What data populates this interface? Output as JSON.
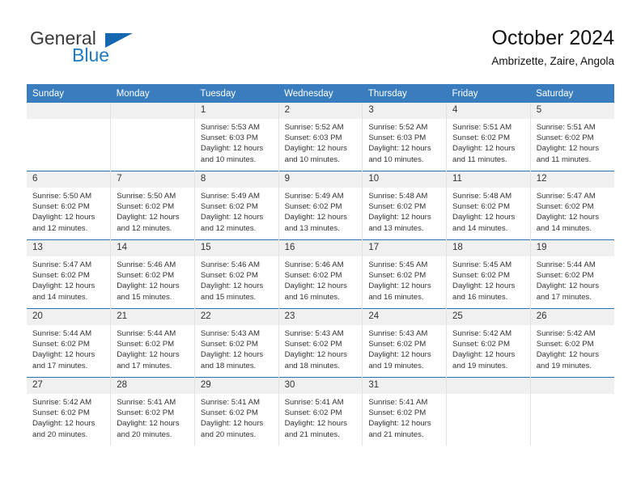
{
  "brand": {
    "name_part1": "General",
    "name_part2": "Blue",
    "accent_color": "#1667b1"
  },
  "header": {
    "title": "October 2024",
    "subtitle": "Ambrizette, Zaire, Angola"
  },
  "theme": {
    "header_bg": "#3a7dbf",
    "week_divider": "#2f6fb0",
    "daynum_bg": "#f0f0f0"
  },
  "calendar": {
    "weekdays": [
      "Sunday",
      "Monday",
      "Tuesday",
      "Wednesday",
      "Thursday",
      "Friday",
      "Saturday"
    ],
    "weeks": [
      [
        {
          "day": "",
          "lines": []
        },
        {
          "day": "",
          "lines": []
        },
        {
          "day": "1",
          "lines": [
            "Sunrise: 5:53 AM",
            "Sunset: 6:03 PM",
            "Daylight: 12 hours",
            "and 10 minutes."
          ]
        },
        {
          "day": "2",
          "lines": [
            "Sunrise: 5:52 AM",
            "Sunset: 6:03 PM",
            "Daylight: 12 hours",
            "and 10 minutes."
          ]
        },
        {
          "day": "3",
          "lines": [
            "Sunrise: 5:52 AM",
            "Sunset: 6:03 PM",
            "Daylight: 12 hours",
            "and 10 minutes."
          ]
        },
        {
          "day": "4",
          "lines": [
            "Sunrise: 5:51 AM",
            "Sunset: 6:02 PM",
            "Daylight: 12 hours",
            "and 11 minutes."
          ]
        },
        {
          "day": "5",
          "lines": [
            "Sunrise: 5:51 AM",
            "Sunset: 6:02 PM",
            "Daylight: 12 hours",
            "and 11 minutes."
          ]
        }
      ],
      [
        {
          "day": "6",
          "lines": [
            "Sunrise: 5:50 AM",
            "Sunset: 6:02 PM",
            "Daylight: 12 hours",
            "and 12 minutes."
          ]
        },
        {
          "day": "7",
          "lines": [
            "Sunrise: 5:50 AM",
            "Sunset: 6:02 PM",
            "Daylight: 12 hours",
            "and 12 minutes."
          ]
        },
        {
          "day": "8",
          "lines": [
            "Sunrise: 5:49 AM",
            "Sunset: 6:02 PM",
            "Daylight: 12 hours",
            "and 12 minutes."
          ]
        },
        {
          "day": "9",
          "lines": [
            "Sunrise: 5:49 AM",
            "Sunset: 6:02 PM",
            "Daylight: 12 hours",
            "and 13 minutes."
          ]
        },
        {
          "day": "10",
          "lines": [
            "Sunrise: 5:48 AM",
            "Sunset: 6:02 PM",
            "Daylight: 12 hours",
            "and 13 minutes."
          ]
        },
        {
          "day": "11",
          "lines": [
            "Sunrise: 5:48 AM",
            "Sunset: 6:02 PM",
            "Daylight: 12 hours",
            "and 14 minutes."
          ]
        },
        {
          "day": "12",
          "lines": [
            "Sunrise: 5:47 AM",
            "Sunset: 6:02 PM",
            "Daylight: 12 hours",
            "and 14 minutes."
          ]
        }
      ],
      [
        {
          "day": "13",
          "lines": [
            "Sunrise: 5:47 AM",
            "Sunset: 6:02 PM",
            "Daylight: 12 hours",
            "and 14 minutes."
          ]
        },
        {
          "day": "14",
          "lines": [
            "Sunrise: 5:46 AM",
            "Sunset: 6:02 PM",
            "Daylight: 12 hours",
            "and 15 minutes."
          ]
        },
        {
          "day": "15",
          "lines": [
            "Sunrise: 5:46 AM",
            "Sunset: 6:02 PM",
            "Daylight: 12 hours",
            "and 15 minutes."
          ]
        },
        {
          "day": "16",
          "lines": [
            "Sunrise: 5:46 AM",
            "Sunset: 6:02 PM",
            "Daylight: 12 hours",
            "and 16 minutes."
          ]
        },
        {
          "day": "17",
          "lines": [
            "Sunrise: 5:45 AM",
            "Sunset: 6:02 PM",
            "Daylight: 12 hours",
            "and 16 minutes."
          ]
        },
        {
          "day": "18",
          "lines": [
            "Sunrise: 5:45 AM",
            "Sunset: 6:02 PM",
            "Daylight: 12 hours",
            "and 16 minutes."
          ]
        },
        {
          "day": "19",
          "lines": [
            "Sunrise: 5:44 AM",
            "Sunset: 6:02 PM",
            "Daylight: 12 hours",
            "and 17 minutes."
          ]
        }
      ],
      [
        {
          "day": "20",
          "lines": [
            "Sunrise: 5:44 AM",
            "Sunset: 6:02 PM",
            "Daylight: 12 hours",
            "and 17 minutes."
          ]
        },
        {
          "day": "21",
          "lines": [
            "Sunrise: 5:44 AM",
            "Sunset: 6:02 PM",
            "Daylight: 12 hours",
            "and 17 minutes."
          ]
        },
        {
          "day": "22",
          "lines": [
            "Sunrise: 5:43 AM",
            "Sunset: 6:02 PM",
            "Daylight: 12 hours",
            "and 18 minutes."
          ]
        },
        {
          "day": "23",
          "lines": [
            "Sunrise: 5:43 AM",
            "Sunset: 6:02 PM",
            "Daylight: 12 hours",
            "and 18 minutes."
          ]
        },
        {
          "day": "24",
          "lines": [
            "Sunrise: 5:43 AM",
            "Sunset: 6:02 PM",
            "Daylight: 12 hours",
            "and 19 minutes."
          ]
        },
        {
          "day": "25",
          "lines": [
            "Sunrise: 5:42 AM",
            "Sunset: 6:02 PM",
            "Daylight: 12 hours",
            "and 19 minutes."
          ]
        },
        {
          "day": "26",
          "lines": [
            "Sunrise: 5:42 AM",
            "Sunset: 6:02 PM",
            "Daylight: 12 hours",
            "and 19 minutes."
          ]
        }
      ],
      [
        {
          "day": "27",
          "lines": [
            "Sunrise: 5:42 AM",
            "Sunset: 6:02 PM",
            "Daylight: 12 hours",
            "and 20 minutes."
          ]
        },
        {
          "day": "28",
          "lines": [
            "Sunrise: 5:41 AM",
            "Sunset: 6:02 PM",
            "Daylight: 12 hours",
            "and 20 minutes."
          ]
        },
        {
          "day": "29",
          "lines": [
            "Sunrise: 5:41 AM",
            "Sunset: 6:02 PM",
            "Daylight: 12 hours",
            "and 20 minutes."
          ]
        },
        {
          "day": "30",
          "lines": [
            "Sunrise: 5:41 AM",
            "Sunset: 6:02 PM",
            "Daylight: 12 hours",
            "and 21 minutes."
          ]
        },
        {
          "day": "31",
          "lines": [
            "Sunrise: 5:41 AM",
            "Sunset: 6:02 PM",
            "Daylight: 12 hours",
            "and 21 minutes."
          ]
        },
        {
          "day": "",
          "lines": []
        },
        {
          "day": "",
          "lines": []
        }
      ]
    ]
  }
}
